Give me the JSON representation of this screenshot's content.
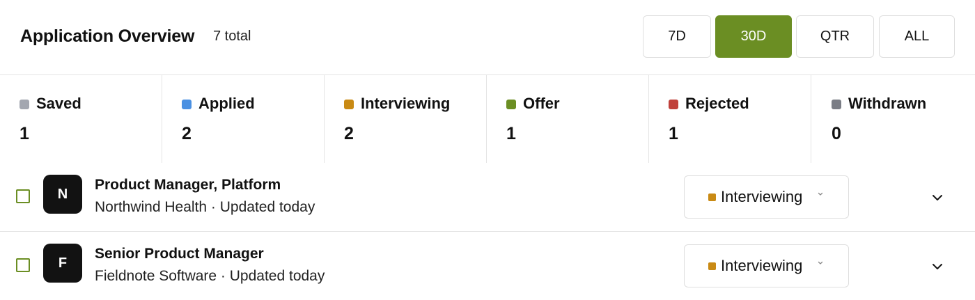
{
  "header": {
    "title": "Application Overview",
    "total": "7 total",
    "ranges": [
      "7D",
      "30D",
      "QTR",
      "ALL"
    ],
    "active_range": "30D"
  },
  "stats": [
    {
      "label": "Saved",
      "value": "1",
      "color": "#a3a7b0"
    },
    {
      "label": "Applied",
      "value": "2",
      "color": "#4a90e2"
    },
    {
      "label": "Interviewing",
      "value": "2",
      "color": "#c98a14"
    },
    {
      "label": "Offer",
      "value": "1",
      "color": "#6b8e23"
    },
    {
      "label": "Rejected",
      "value": "1",
      "color": "#c0413b"
    },
    {
      "label": "Withdrawn",
      "value": "0",
      "color": "#7a7d85"
    }
  ],
  "applications": [
    {
      "initial": "N",
      "role": "Product Manager, Platform",
      "company_line": "Northwind Health · Updated today",
      "status": "Interviewing",
      "status_color": "#c98a14"
    },
    {
      "initial": "F",
      "role": "Senior Product Manager",
      "company_line": "Fieldnote Software · Updated today",
      "status": "Interviewing",
      "status_color": "#c98a14"
    }
  ],
  "colors": {
    "accent": "#6b8e23"
  }
}
